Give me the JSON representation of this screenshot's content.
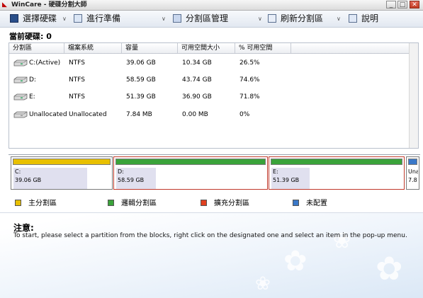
{
  "window": {
    "title": "WinCare - 硬碟分割大師",
    "minimize": "_",
    "maximize": "□",
    "close": "✕"
  },
  "toolbar": {
    "select_disk": "選擇硬碟",
    "prepare": "進行準備",
    "partition_mgmt": "分割區管理",
    "refresh": "刷新分割區",
    "help": "說明"
  },
  "current_disk": {
    "label": "當前硬碟:",
    "value": "0"
  },
  "table": {
    "headers": [
      "分割區",
      "檔案系統",
      "容量",
      "可用空間大小",
      "% 可用空間"
    ],
    "rows": [
      {
        "name": "C:(Active)",
        "fs": "NTFS",
        "capacity": "39.06 GB",
        "free": "10.34 GB",
        "pct": "26.5%"
      },
      {
        "name": "D:",
        "fs": "NTFS",
        "capacity": "58.59 GB",
        "free": "43.74 GB",
        "pct": "74.6%"
      },
      {
        "name": "E:",
        "fs": "NTFS",
        "capacity": "51.39 GB",
        "free": "36.90 GB",
        "pct": "71.8%"
      },
      {
        "name": "Unallocated",
        "fs": "Unallocated",
        "capacity": "7.84 MB",
        "free": "0.00 MB",
        "pct": "0%"
      }
    ]
  },
  "blocks": [
    {
      "label": "C:",
      "size": "39.06 GB"
    },
    {
      "label": "D:",
      "size": "58.59 GB"
    },
    {
      "label": "E:",
      "size": "51.39 GB"
    },
    {
      "label": "Una",
      "size": "7.8"
    }
  ],
  "legend": {
    "primary": "主分割區",
    "logical": "邏輯分割區",
    "extended": "擴充分割區",
    "unallocated": "未配置"
  },
  "notice": {
    "title": "注意:",
    "text": "To start, please select a partition from the blocks, right click on the designated one and select an item in the pop-up menu."
  },
  "colors": {
    "primary": "#e8c000",
    "logical": "#3aa33a",
    "extended": "#e04020",
    "unallocated": "#3a78c8",
    "block_border": "#c0392b"
  }
}
